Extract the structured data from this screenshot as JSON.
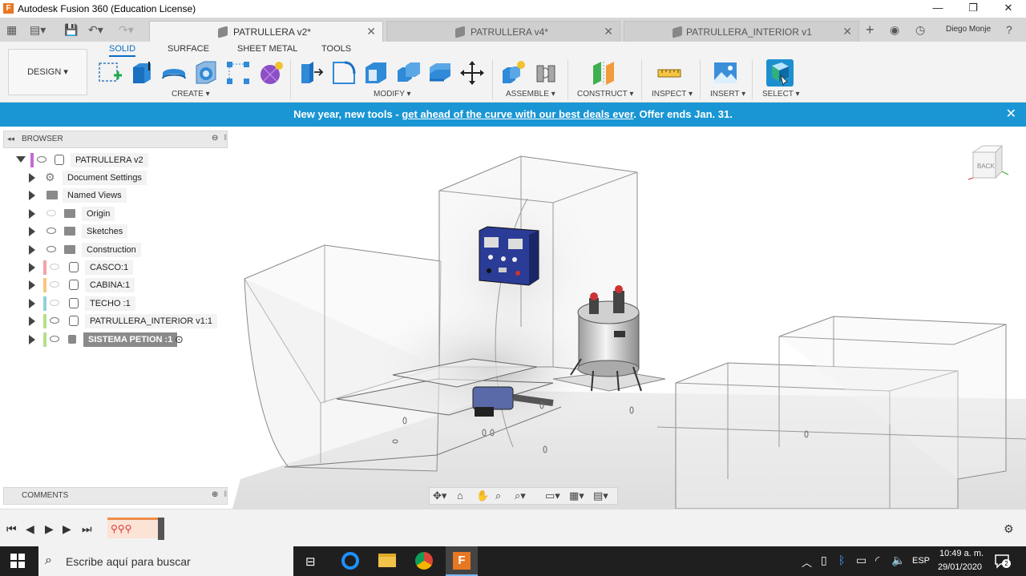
{
  "window": {
    "app_icon": "F",
    "title": "Autodesk Fusion 360 (Education License)",
    "controls": {
      "minimize": "—",
      "restore": "❐",
      "close": "✕"
    }
  },
  "tabs": [
    {
      "label": "PATRULLERA v2*",
      "active": true
    },
    {
      "label": "PATRULLERA v4*",
      "active": false
    },
    {
      "label": "PATRULLERA_INTERIOR v1",
      "active": false
    }
  ],
  "user": {
    "name": "Diego Monje"
  },
  "toolbar": {
    "workspace": "DESIGN ▾",
    "ribbon_tabs": [
      "SOLID",
      "SURFACE",
      "SHEET METAL",
      "TOOLS"
    ],
    "groups": [
      "CREATE ▾",
      "MODIFY ▾",
      "ASSEMBLE ▾",
      "CONSTRUCT ▾",
      "INSPECT ▾",
      "INSERT ▾",
      "SELECT ▾"
    ]
  },
  "banner": {
    "text_before": "New year, new tools - ",
    "link": "get ahead of the curve with our best deals ever",
    "text_after": ". Offer ends Jan. 31.",
    "close": "✕"
  },
  "browser": {
    "header": "BROWSER",
    "root": "PATRULLERA v2",
    "items": [
      {
        "label": "Document Settings",
        "icon": "gear-icon",
        "visible": null
      },
      {
        "label": "Named Views",
        "icon": "folder-icon",
        "visible": null
      },
      {
        "label": "Origin",
        "icon": "folder-icon",
        "visible": false
      },
      {
        "label": "Sketches",
        "icon": "folder-icon",
        "visible": true
      },
      {
        "label": "Construction",
        "icon": "folder-icon",
        "visible": true
      },
      {
        "label": "CASCO:1",
        "icon": "component-icon",
        "visible": false,
        "color": "#f4a3a8"
      },
      {
        "label": "CABINA:1",
        "icon": "component-icon",
        "visible": false,
        "color": "#f7c77c"
      },
      {
        "label": "TECHO :1",
        "icon": "component-icon",
        "visible": false,
        "color": "#8fd3d8"
      },
      {
        "label": "PATRULLERA_INTERIOR v1:1",
        "icon": "component-icon",
        "visible": true,
        "color": "#b5df8a"
      },
      {
        "label": "SISTEMA PETION :1",
        "icon": "component-icon",
        "visible": true,
        "color": "#b5df8a",
        "active": true
      }
    ]
  },
  "comments": {
    "header": "COMMENTS"
  },
  "viewcube": {
    "face": "BACK"
  },
  "taskbar": {
    "search_placeholder": "Escribe aquí para buscar",
    "language": "ESP",
    "time": "10:49 a. m.",
    "date": "29/01/2020",
    "notifications": "2"
  }
}
